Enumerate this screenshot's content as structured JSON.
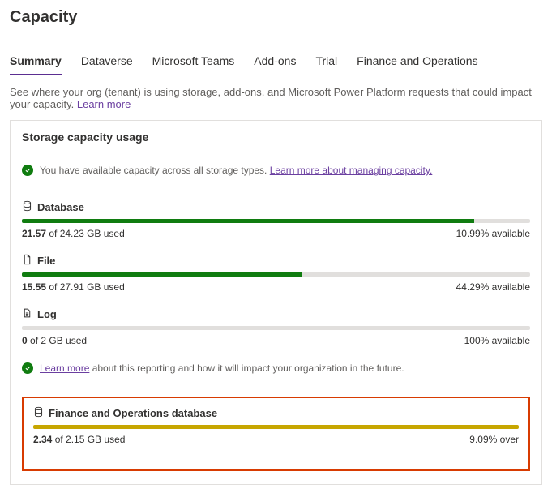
{
  "pageTitle": "Capacity",
  "tabs": [
    {
      "label": "Summary",
      "active": true
    },
    {
      "label": "Dataverse",
      "active": false
    },
    {
      "label": "Microsoft Teams",
      "active": false
    },
    {
      "label": "Add-ons",
      "active": false
    },
    {
      "label": "Trial",
      "active": false
    },
    {
      "label": "Finance and Operations",
      "active": false
    }
  ],
  "descText": "See where your org (tenant) is using storage, add-ons, and Microsoft Power Platform requests that could impact your capacity. ",
  "descLink": "Learn more",
  "cardTitle": "Storage capacity usage",
  "statusMsg": "You have available capacity across all storage types. ",
  "statusLink": "Learn more about managing capacity.",
  "items": [
    {
      "name": "Database",
      "usedBold": "21.57",
      "usedRest": " of 24.23 GB used",
      "avail": "10.99% available",
      "pct": 89,
      "color": "green",
      "icon": "db"
    },
    {
      "name": "File",
      "usedBold": "15.55",
      "usedRest": " of 27.91 GB used",
      "avail": "44.29% available",
      "pct": 55,
      "color": "green",
      "icon": "file"
    },
    {
      "name": "Log",
      "usedBold": "0",
      "usedRest": " of 2 GB used",
      "avail": "100% available",
      "pct": 0,
      "color": "green",
      "icon": "log"
    }
  ],
  "infoLink": "Learn more",
  "infoRest": " about this reporting and how it will impact your organization in the future.",
  "foItem": {
    "name": "Finance and Operations database",
    "usedBold": "2.34",
    "usedRest": " of 2.15 GB used",
    "avail": "9.09% over",
    "pct": 100,
    "icon": "db"
  }
}
